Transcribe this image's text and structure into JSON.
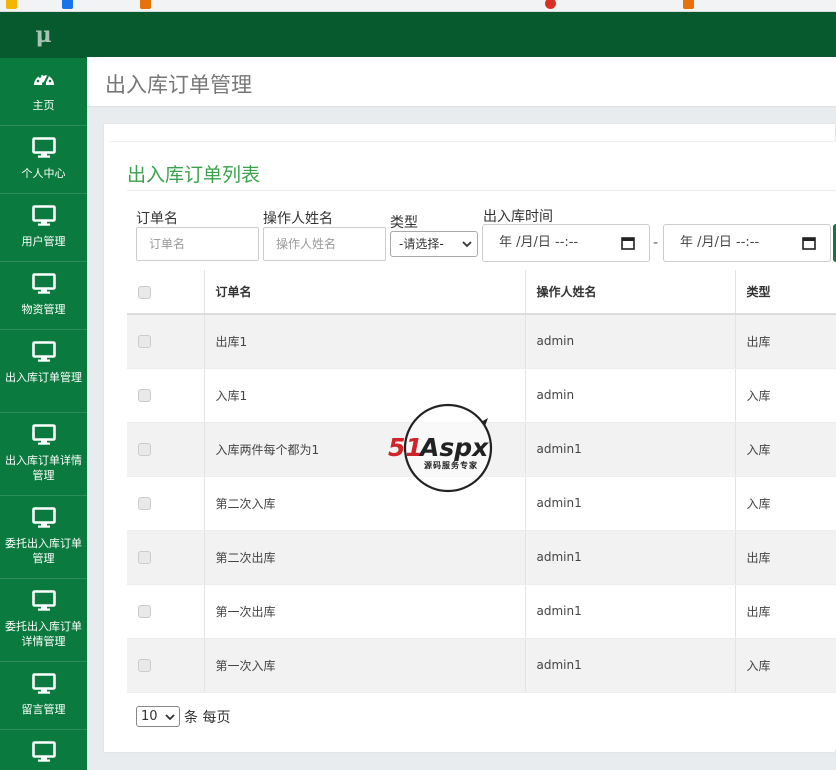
{
  "sidebar": {
    "brand": "μ",
    "items": [
      {
        "label": "主页",
        "icon": "dashboard-icon"
      },
      {
        "label": "个人中心",
        "icon": "monitor-icon"
      },
      {
        "label": "用户管理",
        "icon": "monitor-icon"
      },
      {
        "label": "物资管理",
        "icon": "monitor-icon"
      },
      {
        "label": "出入库订单管理",
        "icon": "monitor-icon"
      },
      {
        "label": "出入库订单详情管理",
        "icon": "monitor-icon"
      },
      {
        "label": "委托出入库订单管理",
        "icon": "monitor-icon"
      },
      {
        "label": "委托出入库订单详情管理",
        "icon": "monitor-icon"
      },
      {
        "label": "留言管理",
        "icon": "monitor-icon"
      },
      {
        "label": "",
        "icon": "monitor-icon"
      }
    ]
  },
  "page": {
    "title": "出入库订单管理",
    "card_title": "出入库订单列表"
  },
  "filters": {
    "order_name_label": "订单名",
    "order_name_placeholder": "订单名",
    "operator_label": "操作人姓名",
    "operator_placeholder": "操作人姓名",
    "type_label": "类型",
    "type_selected": "-请选择-",
    "time_label": "出入库时间",
    "date_start": "年 /月/日 --:--",
    "date_end": "年 /月/日 --:--",
    "range_sep": "-"
  },
  "table": {
    "headers": [
      "订单名",
      "操作人姓名",
      "类型"
    ],
    "rows": [
      {
        "name": "出库1",
        "operator": "admin",
        "type": "出库"
      },
      {
        "name": "入库1",
        "operator": "admin",
        "type": "入库"
      },
      {
        "name": "入库两件每个都为1",
        "operator": "admin1",
        "type": "入库"
      },
      {
        "name": "第二次入库",
        "operator": "admin1",
        "type": "入库"
      },
      {
        "name": "第二次出库",
        "operator": "admin1",
        "type": "出库"
      },
      {
        "name": "第一次出库",
        "operator": "admin1",
        "type": "出库"
      },
      {
        "name": "第一次入库",
        "operator": "admin1",
        "type": "入库"
      }
    ]
  },
  "pager": {
    "page_size": "10",
    "suffix": "条 每页"
  },
  "watermark": {
    "brand": "51Aspx",
    "tagline": "源码服务专家"
  },
  "colors": {
    "sidebar": "#0a7a3e",
    "header": "#075a2d",
    "accent": "#3aa24c"
  }
}
